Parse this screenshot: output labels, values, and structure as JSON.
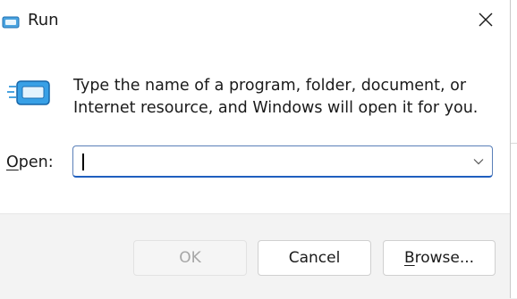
{
  "window": {
    "title": "Run",
    "icon": "run-icon",
    "close_icon": "close-icon"
  },
  "main": {
    "description": "Type the name of a program, folder, document, or Internet resource, and Windows will open it for you.",
    "icon": "run-large-icon"
  },
  "open_field": {
    "label_underlined": "O",
    "label_rest": "pen:",
    "value": "",
    "dropdown_icon": "chevron-down-icon"
  },
  "buttons": {
    "ok_label": "OK",
    "cancel_label": "Cancel",
    "browse_underlined": "B",
    "browse_rest": "rowse..."
  },
  "colors": {
    "accent": "#1f5fbf",
    "disabled_text": "#a6a6a6"
  }
}
